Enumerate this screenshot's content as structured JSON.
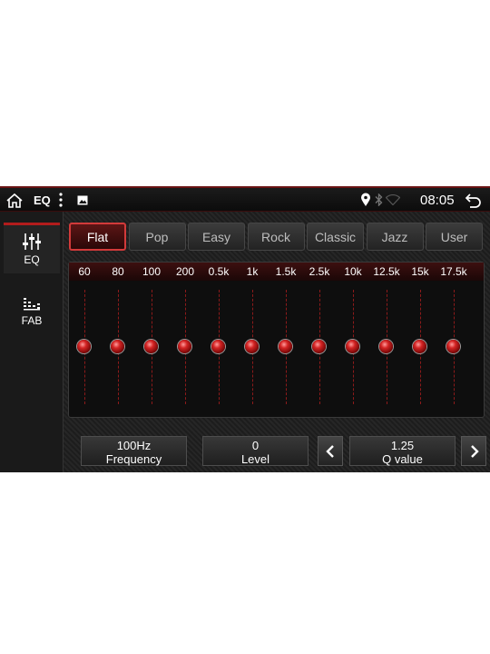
{
  "statusbar": {
    "title": "EQ",
    "time": "08:05",
    "icons": [
      "home-icon",
      "more-vert-icon",
      "image-icon",
      "location-icon",
      "bluetooth-icon",
      "wifi-icon",
      "back-icon"
    ]
  },
  "sidebar": {
    "items": [
      {
        "label": "EQ",
        "icon": "equalizer-sliders-icon",
        "active": true
      },
      {
        "label": "FAB",
        "icon": "fader-balance-icon",
        "active": false
      }
    ]
  },
  "presets": [
    "Flat",
    "Pop",
    "Easy",
    "Rock",
    "Classic",
    "Jazz",
    "User"
  ],
  "selected_preset": "Flat",
  "bands": [
    "60",
    "80",
    "100",
    "200",
    "0.5k",
    "1k",
    "1.5k",
    "2.5k",
    "10k",
    "12.5k",
    "15k",
    "17.5k"
  ],
  "band_levels": [
    0,
    0,
    0,
    0,
    0,
    0,
    0,
    0,
    0,
    0,
    0,
    0
  ],
  "controls": {
    "frequency": {
      "value": "100Hz",
      "label": "Frequency"
    },
    "level": {
      "value": "0",
      "label": "Level"
    },
    "q": {
      "value": "1.25",
      "label": "Q value"
    }
  },
  "colors": {
    "accent": "#d23a3a",
    "background": "#141414",
    "knob": "#c21f1f"
  }
}
